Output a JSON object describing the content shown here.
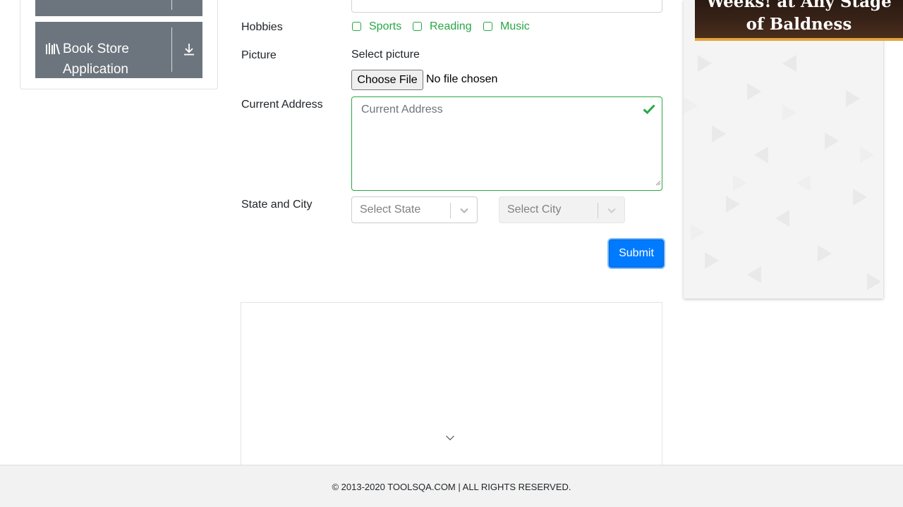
{
  "sidebar": {
    "book_store_label": "Book Store Application"
  },
  "form": {
    "hobbies_label": "Hobbies",
    "hobbies": [
      "Sports",
      "Reading",
      "Music"
    ],
    "picture_label": "Picture",
    "picture_prompt": "Select picture",
    "file_button": "Choose File",
    "file_status": "No file chosen",
    "address_label": "Current Address",
    "address_placeholder": "Current Address",
    "state_city_label": "State and City",
    "state_placeholder": "Select State",
    "city_placeholder": "Select City",
    "submit_label": "Submit"
  },
  "ad": {
    "headline": "Weeks! at Any Stage of Baldness"
  },
  "footer": {
    "copyright": "© 2013-2020 TOOLSQA.COM | ALL RIGHTS RESERVED."
  },
  "colors": {
    "valid_green": "#28a745",
    "primary_blue": "#007bff",
    "menu_gray": "#6c757d",
    "ad_accent": "#e3a33b"
  }
}
